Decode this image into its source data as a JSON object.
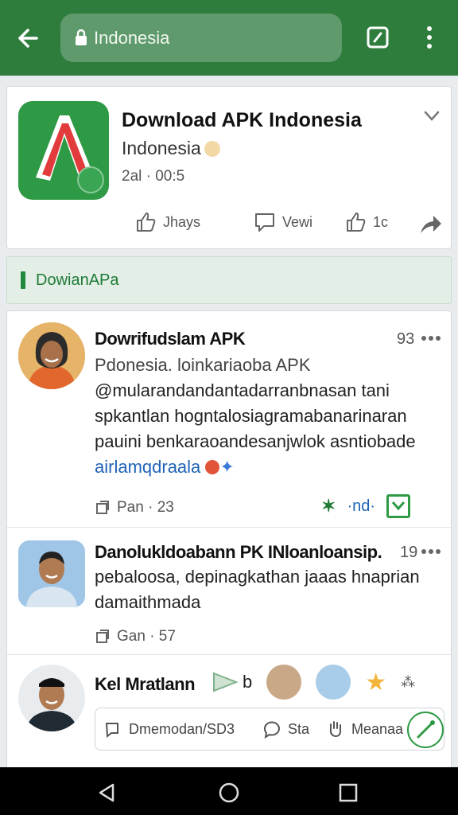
{
  "browser": {
    "url_text": "Indonesia",
    "icons": {
      "back": "back-arrow-icon",
      "lock": "lock-icon",
      "tabs": "tab-switcher-icon",
      "menu": "more-vertical-icon"
    }
  },
  "app_card": {
    "title": "Download APK Indonesia",
    "subtitle": "Indonesia",
    "time": "2al · 00:5",
    "actions": [
      {
        "label": "Jhays",
        "icon": "thumbs-up-icon"
      },
      {
        "label": "Vewi",
        "icon": "comment-icon"
      },
      {
        "label": "1c",
        "icon": "share-icon"
      }
    ],
    "expand_icon": "chevron-down-icon",
    "forward_icon": "forward-arrow-icon"
  },
  "section": {
    "label": "DowianAPa"
  },
  "posts": [
    {
      "name": "Dowrifudslam APK",
      "meta": "93",
      "lines": [
        "Pdonesia. loinkariaoba APK",
        "@mularandandantadarranbnasan tani",
        "spkantlan hogntalosiagramabanarinaran",
        "pauini benkaraoandesanjwlok asntiobade"
      ],
      "tag": "airlamqdraala",
      "footer": "Pan · 23",
      "reaction_text": "·nd·"
    },
    {
      "name": "Danolukldoabann PK INloanloansip.",
      "meta": "19",
      "lines": [
        "pebaloosa, depinagkathan jaaas hnaprian",
        "damaithmada"
      ],
      "footer": "Gan · 57"
    },
    {
      "name": "Kel Mratlann",
      "suffix": "b",
      "composer": [
        {
          "label": "Dmemodan/SD3",
          "icon": "message-icon"
        },
        {
          "label": "Sta",
          "icon": "chat-icon"
        },
        {
          "label": "Meanaa",
          "icon": "hand-icon"
        }
      ]
    }
  ],
  "colors": {
    "header": "#2e7d3d",
    "accent": "#1f7a36",
    "link": "#1f63b6"
  }
}
